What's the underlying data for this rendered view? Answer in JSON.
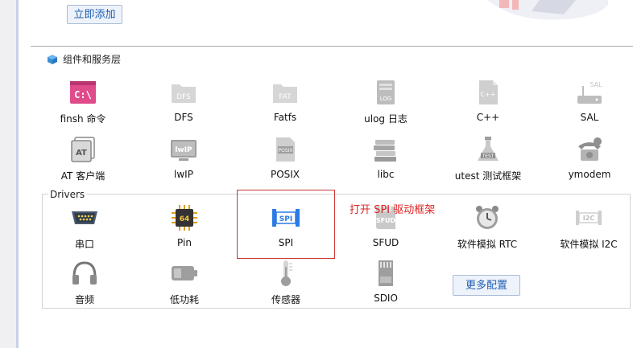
{
  "add_button": "立即添加",
  "section_title": "组件和服务层",
  "components": [
    {
      "label": "finsh 命令",
      "icon": "terminal-icon"
    },
    {
      "label": "DFS",
      "icon": "folder-icon"
    },
    {
      "label": "Fatfs",
      "icon": "folder-icon"
    },
    {
      "label": "ulog 日志",
      "icon": "log-file-icon"
    },
    {
      "label": "C++",
      "icon": "cpp-file-icon"
    },
    {
      "label": "SAL",
      "icon": "router-icon"
    },
    {
      "label": "AT 客户端",
      "icon": "at-icon"
    },
    {
      "label": "lwIP",
      "icon": "lwip-icon"
    },
    {
      "label": "POSIX",
      "icon": "posix-file-icon"
    },
    {
      "label": "libc",
      "icon": "books-icon"
    },
    {
      "label": "utest 测试框架",
      "icon": "flask-icon"
    },
    {
      "label": "ymodem",
      "icon": "phone-icon"
    }
  ],
  "drivers_label": "Drivers",
  "drivers": [
    {
      "label": "串口",
      "icon": "serial-port-icon"
    },
    {
      "label": "Pin",
      "icon": "chip-icon"
    },
    {
      "label": "SPI",
      "icon": "spi-icon"
    },
    {
      "label": "SFUD",
      "icon": "sfud-icon"
    },
    {
      "label": "软件模拟 RTC",
      "icon": "alarm-clock-icon"
    },
    {
      "label": "软件模拟 I2C",
      "icon": "i2c-icon"
    },
    {
      "label": "音频",
      "icon": "headphones-icon"
    },
    {
      "label": "低功耗",
      "icon": "battery-icon"
    },
    {
      "label": "传感器",
      "icon": "thermometer-icon"
    },
    {
      "label": "SDIO",
      "icon": "sd-card-icon"
    }
  ],
  "more_button": "更多配置",
  "annotation": "打开 SPI 驱动框架"
}
